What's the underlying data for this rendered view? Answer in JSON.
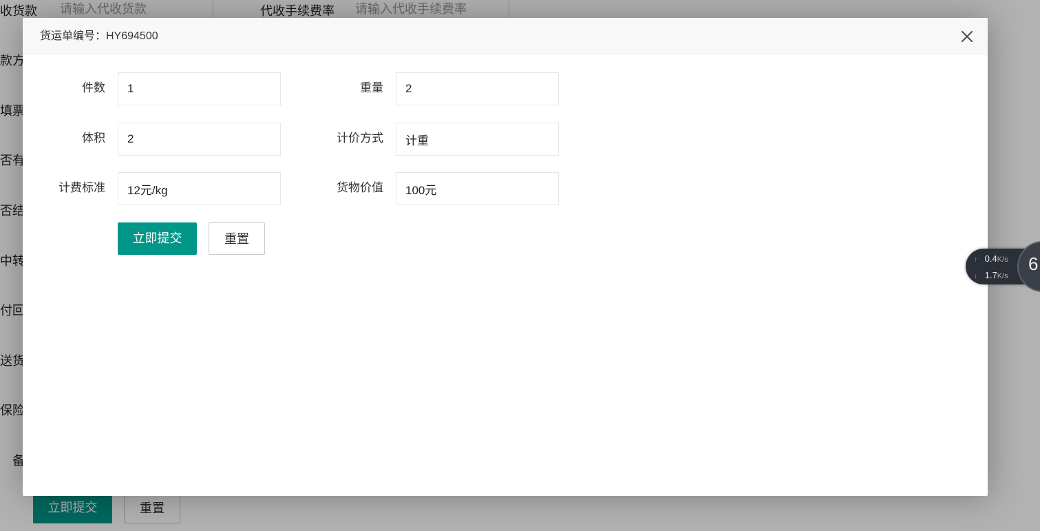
{
  "background": {
    "top_row": {
      "label_1": "收货款",
      "input_1_placeholder": "请输入代收货款",
      "label_2": "代收手续费率",
      "input_2_placeholder": "请输入代收手续费率"
    },
    "side_labels": [
      "款方",
      "填票",
      "否有",
      "否结",
      "中转",
      "付回",
      "送货",
      "保险",
      "备"
    ],
    "submit_label": "立即提交",
    "reset_label": "重置"
  },
  "modal": {
    "title": "货运单编号：HY694500",
    "fields": {
      "pieces": {
        "label": "件数",
        "value": "1"
      },
      "weight": {
        "label": "重量",
        "value": "2"
      },
      "volume": {
        "label": "体积",
        "value": "2"
      },
      "pricing_method": {
        "label": "计价方式",
        "value": "计重"
      },
      "rate": {
        "label": "计费标准",
        "value": "12元/kg"
      },
      "cargo_value": {
        "label": "货物价值",
        "value": "100元"
      }
    },
    "submit_label": "立即提交",
    "reset_label": "重置"
  },
  "speed_widget": {
    "upload": "0.4",
    "download": "1.7",
    "unit": "K/s",
    "circle_text": "6",
    "upload_color": "#4aa3ff",
    "download_color": "#2ecc40"
  }
}
